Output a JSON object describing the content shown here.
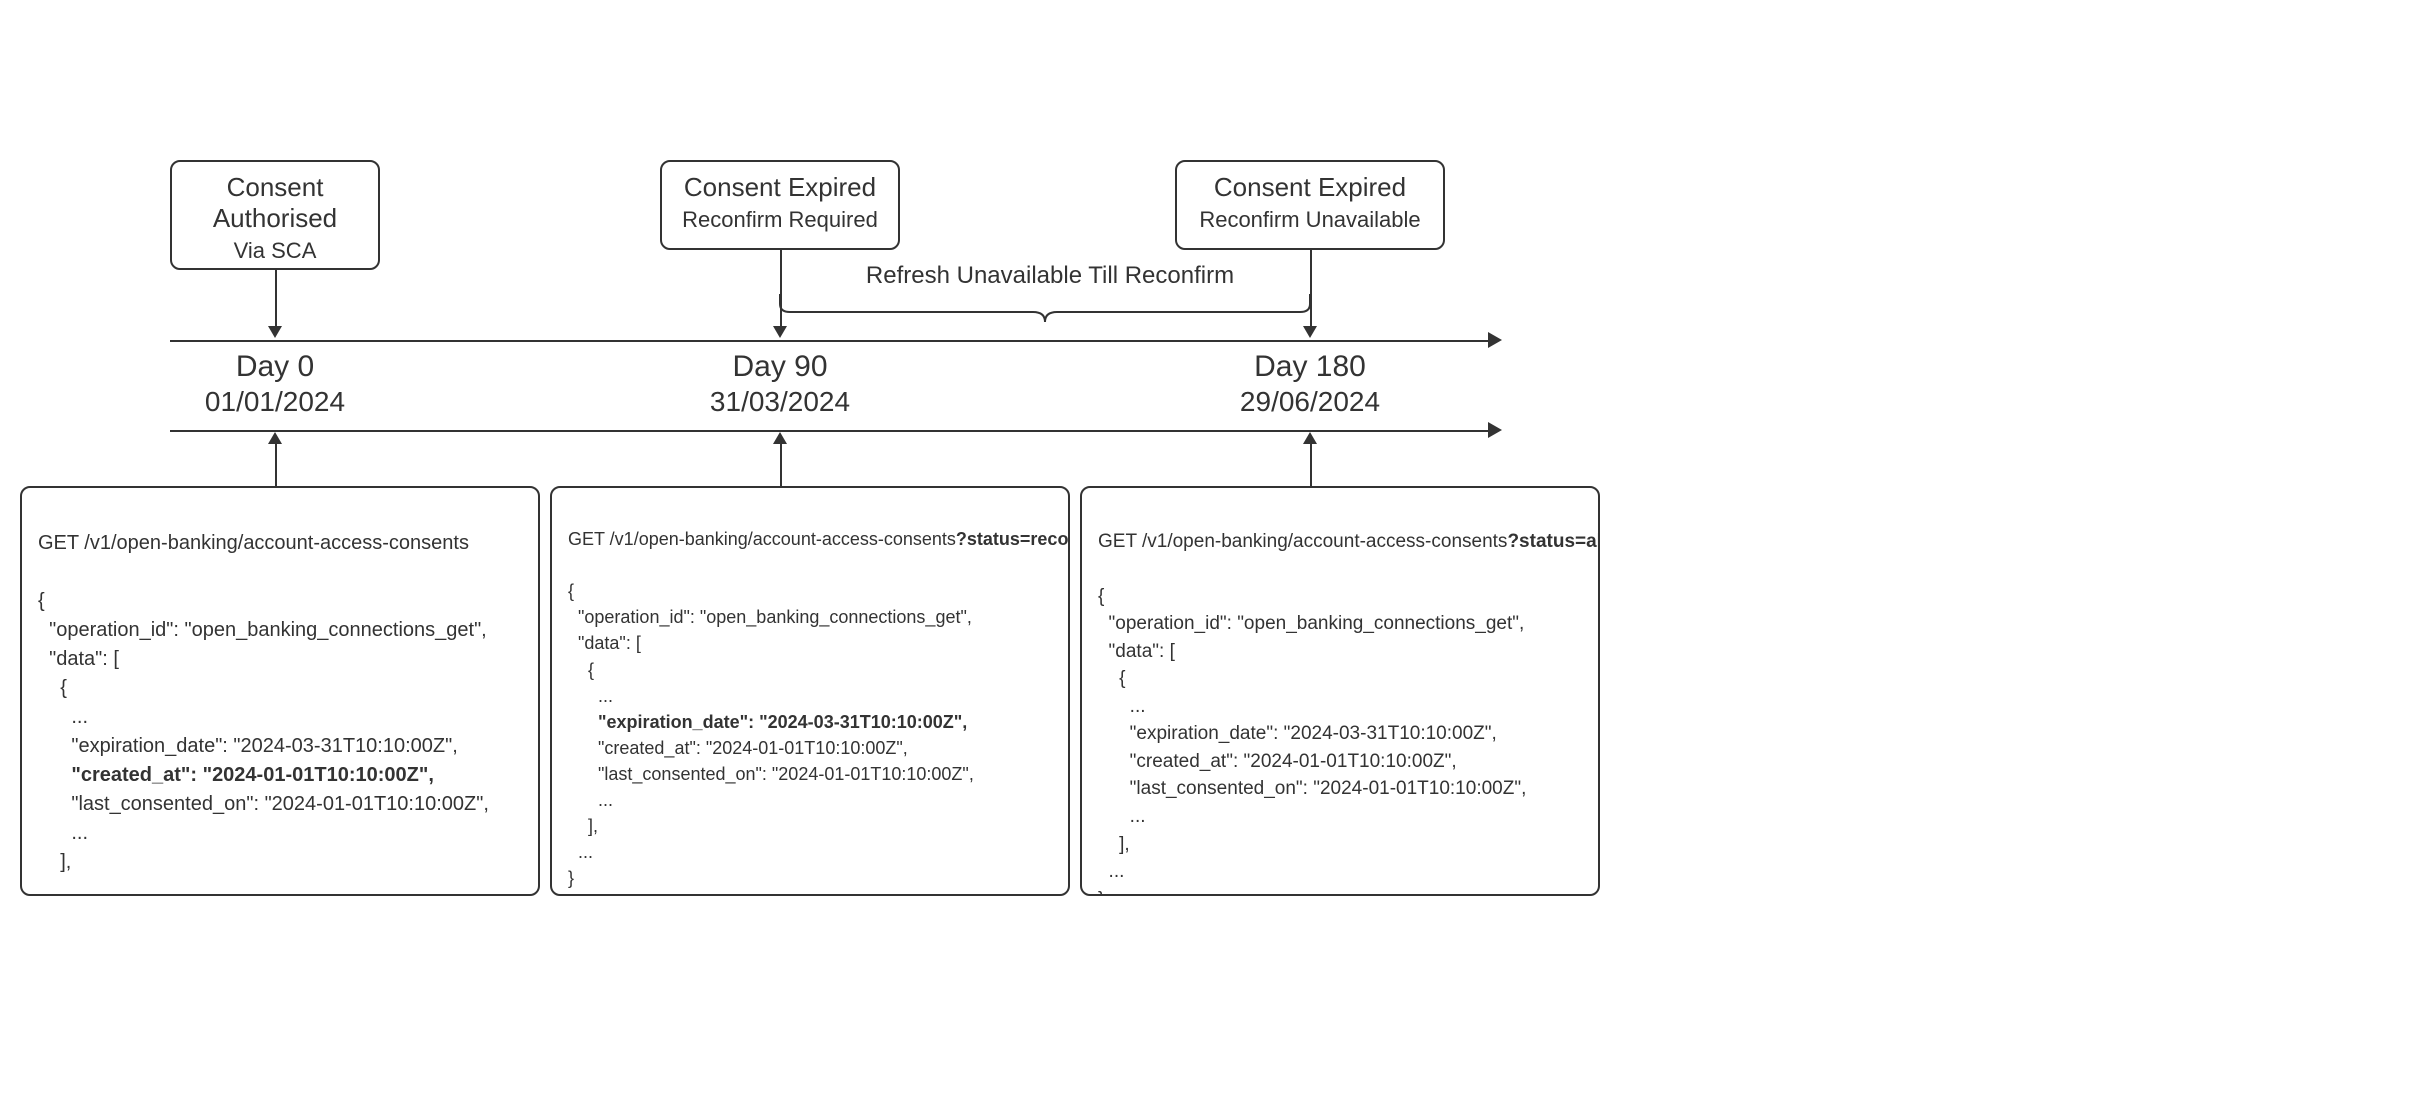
{
  "consent_boxes": [
    {
      "title_l1": "Consent",
      "title_l2": "Authorised",
      "sub": "Via SCA"
    },
    {
      "title_l1": "Consent Expired",
      "title_l2": "",
      "sub": "Reconfirm Required"
    },
    {
      "title_l1": "Consent Expired",
      "title_l2": "",
      "sub": "Reconfirm Unavailable"
    }
  ],
  "brace_note": "Refresh Unavailable Till Reconfirm",
  "milestones": [
    {
      "day": "Day 0",
      "date": "01/01/2024"
    },
    {
      "day": "Day 90",
      "date": "31/03/2024"
    },
    {
      "day": "Day 180",
      "date": "29/06/2024"
    }
  ],
  "code_blocks": [
    {
      "endpoint_prefix": "GET /v1/open-banking/account-access-consents",
      "endpoint_suffix_bold": "",
      "op": "  \"operation_id\": \"open_banking_connections_get\",",
      "data_open": "  \"data\": [",
      "brace_open": "    {",
      "dots1": "      ...",
      "exp_line_plain": "      \"expiration_date\": \"2024-03-31T10:10:00Z\",",
      "exp_line_bold": "",
      "created_line_plain": "",
      "created_line_bold": "      \"created_at\": \"2024-01-01T10:10:00Z\",",
      "last_line": "      \"last_consented_on\": \"2024-01-01T10:10:00Z\",",
      "dots2": "      ...",
      "arr_close": "    ],",
      "dots3": "  ...",
      "obj_close": "}"
    },
    {
      "endpoint_prefix": "GET /v1/open-banking/account-access-consents",
      "endpoint_suffix_bold": "?status=reconfirm_due",
      "op": "  \"operation_id\": \"open_banking_connections_get\",",
      "data_open": "  \"data\": [",
      "brace_open": "    {",
      "dots1": "      ...",
      "exp_line_plain": "",
      "exp_line_bold": "      \"expiration_date\": \"2024-03-31T10:10:00Z\",",
      "created_line_plain": "      \"created_at\": \"2024-01-01T10:10:00Z\",",
      "created_line_bold": "",
      "last_line": "      \"last_consented_on\": \"2024-01-01T10:10:00Z\",",
      "dots2": "      ...",
      "arr_close": "    ],",
      "dots3": "  ...",
      "obj_close": "}"
    },
    {
      "endpoint_prefix": "GET /v1/open-banking/account-access-consents",
      "endpoint_suffix_bold": "?status=all",
      "op": "  \"operation_id\": \"open_banking_connections_get\",",
      "data_open": "  \"data\": [",
      "brace_open": "    {",
      "dots1": "      ...",
      "exp_line_plain": "      \"expiration_date\": \"2024-03-31T10:10:00Z\",",
      "exp_line_bold": "",
      "created_line_plain": "      \"created_at\": \"2024-01-01T10:10:00Z\",",
      "created_line_bold": "",
      "last_line": "      \"last_consented_on\": \"2024-01-01T10:10:00Z\",",
      "dots2": "      ...",
      "arr_close": "    ],",
      "dots3": "  ...",
      "obj_close": "}"
    }
  ],
  "open_brace": "{"
}
